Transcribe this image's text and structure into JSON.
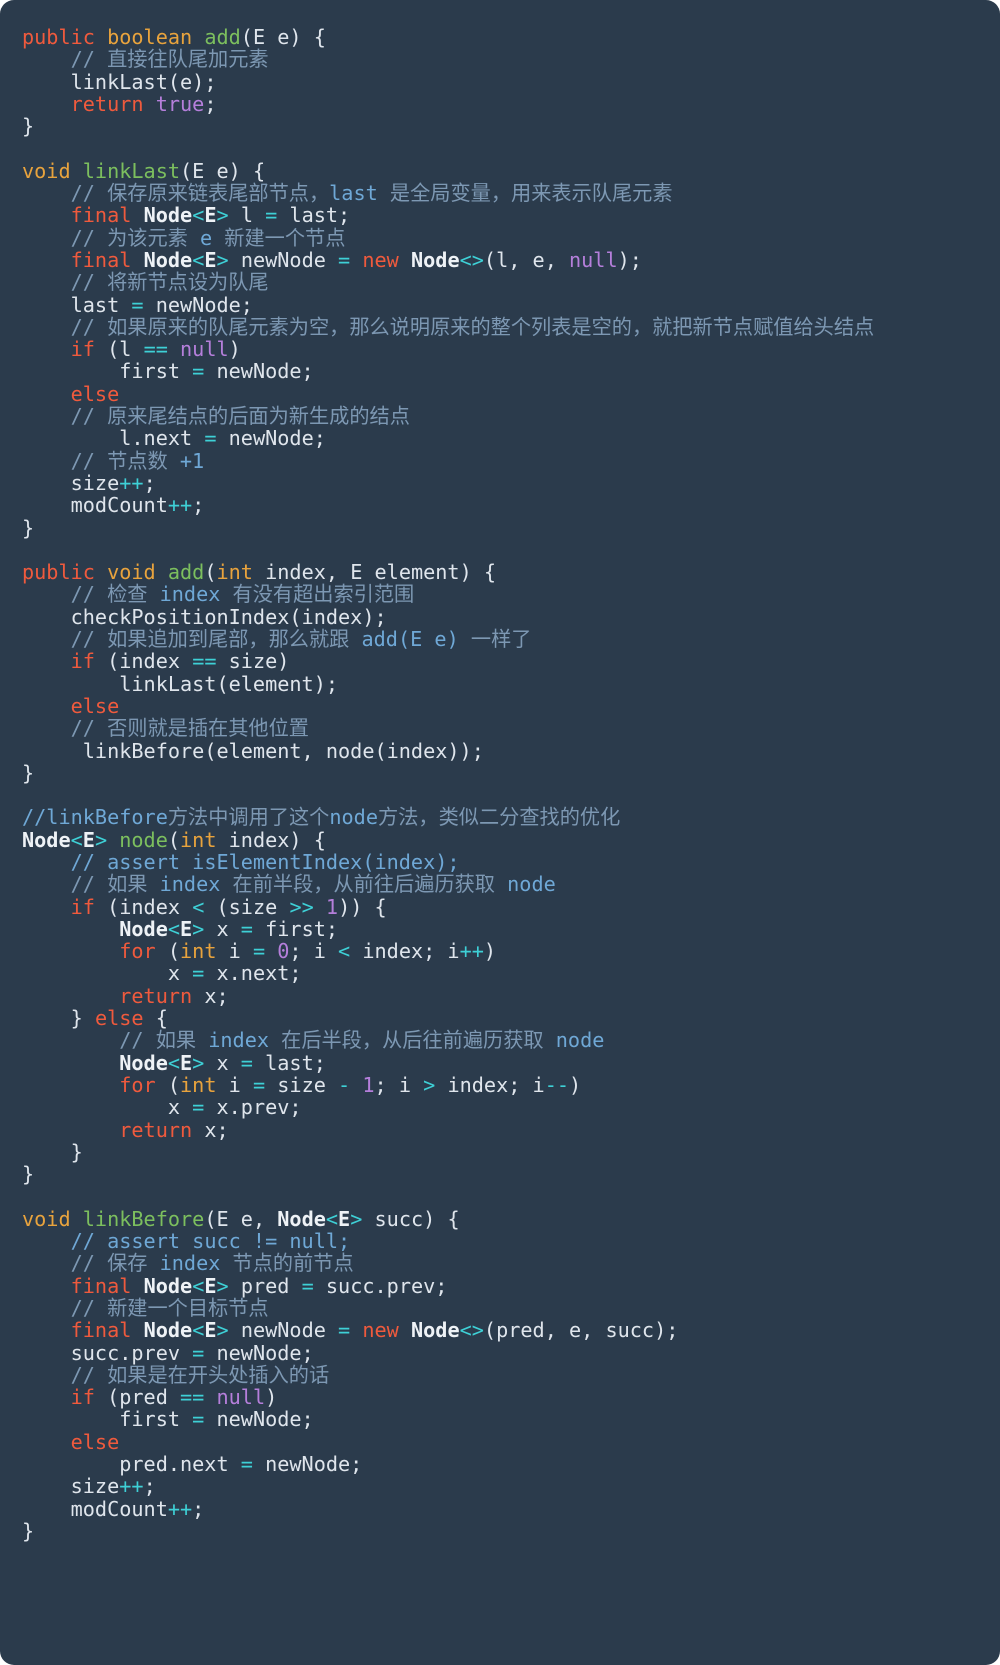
{
  "card": {
    "background_color": "#2b3b4c",
    "corner_radius_px": 14,
    "language": "java",
    "title": "LinkedList add / linkLast / node / linkBefore source with Chinese annotations"
  },
  "theme": {
    "background": "#2b3b4c",
    "foreground": "#dfe5ec",
    "keyword": "#ef5a3d",
    "type": "#e8a33d",
    "function": "#7cbf5e",
    "operator": "#3ed0d6",
    "literal": "#b57fdb",
    "comment": "#7d98b3",
    "comment_ascii": "#6fa8d6",
    "class_name": "#eef2f6"
  },
  "code": {
    "lines": [
      "public boolean add(E e) {",
      "    // 直接往队尾加元素",
      "    linkLast(e);",
      "    return true;",
      "}",
      "",
      "void linkLast(E e) {",
      "    // 保存原来链表尾部节点，last 是全局变量，用来表示队尾元素",
      "    final Node<E> l = last;",
      "    // 为该元素 e 新建一个节点",
      "    final Node<E> newNode = new Node<>(l, e, null);",
      "    // 将新节点设为队尾",
      "    last = newNode;",
      "    // 如果原来的队尾元素为空，那么说明原来的整个列表是空的，就把新节点赋值给头结点",
      "    if (l == null)",
      "        first = newNode;",
      "    else",
      "    // 原来尾结点的后面为新生成的结点",
      "        l.next = newNode;",
      "    // 节点数 +1",
      "    size++;",
      "    modCount++;",
      "}",
      "",
      "public void add(int index, E element) {",
      "    // 检查 index 有没有超出索引范围",
      "    checkPositionIndex(index);",
      "    // 如果追加到尾部，那么就跟 add(E e) 一样了",
      "    if (index == size)",
      "        linkLast(element);",
      "    else",
      "    // 否则就是插在其他位置",
      "     linkBefore(element, node(index));",
      "}",
      "",
      "//linkBefore方法中调用了这个node方法，类似二分查找的优化",
      "Node<E> node(int index) {",
      "    // assert isElementIndex(index);",
      "    // 如果 index 在前半段，从前往后遍历获取 node",
      "    if (index < (size >> 1)) {",
      "        Node<E> x = first;",
      "        for (int i = 0; i < index; i++)",
      "            x = x.next;",
      "        return x;",
      "    } else {",
      "        // 如果 index 在后半段，从后往前遍历获取 node",
      "        Node<E> x = last;",
      "        for (int i = size - 1; i > index; i--)",
      "            x = x.prev;",
      "        return x;",
      "    }",
      "}",
      "",
      "void linkBefore(E e, Node<E> succ) {",
      "    // assert succ != null;",
      "    // 保存 index 节点的前节点",
      "    final Node<E> pred = succ.prev;",
      "    // 新建一个目标节点",
      "    final Node<E> newNode = new Node<>(pred, e, succ);",
      "    succ.prev = newNode;",
      "    // 如果是在开头处插入的话",
      "    if (pred == null)",
      "        first = newNode;",
      "    else",
      "        pred.next = newNode;",
      "    size++;",
      "    modCount++;",
      "}"
    ],
    "comments": [
      "直接往队尾加元素",
      "保存原来链表尾部节点，last 是全局变量，用来表示队尾元素",
      "为该元素 e 新建一个节点",
      "将新节点设为队尾",
      "如果原来的队尾元素为空，那么说明原来的整个列表是空的，就把新节点赋值给头结点",
      "原来尾结点的后面为新生成的结点",
      "节点数 +1",
      "检查 index 有没有超出索引范围",
      "如果追加到尾部，那么就跟 add(E e) 一样了",
      "否则就是插在其他位置",
      "linkBefore方法中调用了这个node方法，类似二分查找的优化",
      "assert isElementIndex(index);",
      "如果 index 在前半段，从前往后遍历获取 node",
      "如果 index 在后半段，从后往前遍历获取 node",
      "assert succ != null;",
      "保存 index 节点的前节点",
      "新建一个目标节点",
      "如果是在开头处插入的话"
    ],
    "methods": [
      "add(E e)",
      "linkLast(E e)",
      "add(int index, E element)",
      "node(int index)",
      "linkBefore(E e, Node<E> succ)"
    ]
  }
}
